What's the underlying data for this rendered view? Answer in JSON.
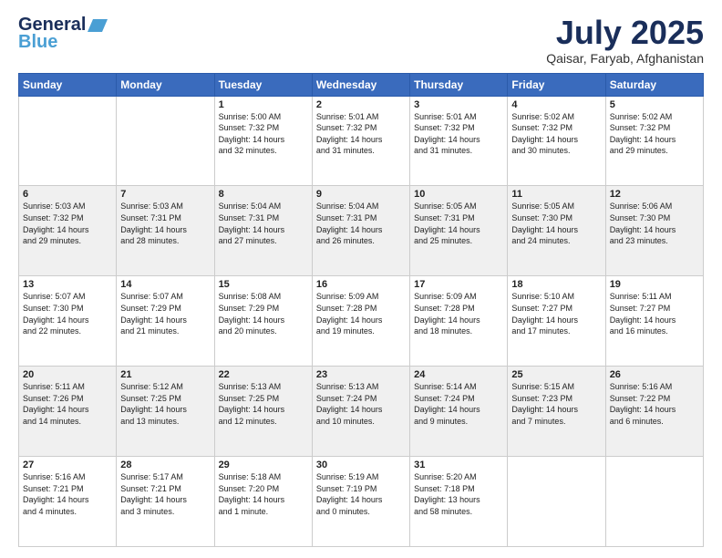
{
  "logo": {
    "line1": "General",
    "line2": "Blue"
  },
  "title": "July 2025",
  "subtitle": "Qaisar, Faryab, Afghanistan",
  "weekdays": [
    "Sunday",
    "Monday",
    "Tuesday",
    "Wednesday",
    "Thursday",
    "Friday",
    "Saturday"
  ],
  "weeks": [
    [
      {
        "day": "",
        "info": ""
      },
      {
        "day": "",
        "info": ""
      },
      {
        "day": "1",
        "info": "Sunrise: 5:00 AM\nSunset: 7:32 PM\nDaylight: 14 hours\nand 32 minutes."
      },
      {
        "day": "2",
        "info": "Sunrise: 5:01 AM\nSunset: 7:32 PM\nDaylight: 14 hours\nand 31 minutes."
      },
      {
        "day": "3",
        "info": "Sunrise: 5:01 AM\nSunset: 7:32 PM\nDaylight: 14 hours\nand 31 minutes."
      },
      {
        "day": "4",
        "info": "Sunrise: 5:02 AM\nSunset: 7:32 PM\nDaylight: 14 hours\nand 30 minutes."
      },
      {
        "day": "5",
        "info": "Sunrise: 5:02 AM\nSunset: 7:32 PM\nDaylight: 14 hours\nand 29 minutes."
      }
    ],
    [
      {
        "day": "6",
        "info": "Sunrise: 5:03 AM\nSunset: 7:32 PM\nDaylight: 14 hours\nand 29 minutes."
      },
      {
        "day": "7",
        "info": "Sunrise: 5:03 AM\nSunset: 7:31 PM\nDaylight: 14 hours\nand 28 minutes."
      },
      {
        "day": "8",
        "info": "Sunrise: 5:04 AM\nSunset: 7:31 PM\nDaylight: 14 hours\nand 27 minutes."
      },
      {
        "day": "9",
        "info": "Sunrise: 5:04 AM\nSunset: 7:31 PM\nDaylight: 14 hours\nand 26 minutes."
      },
      {
        "day": "10",
        "info": "Sunrise: 5:05 AM\nSunset: 7:31 PM\nDaylight: 14 hours\nand 25 minutes."
      },
      {
        "day": "11",
        "info": "Sunrise: 5:05 AM\nSunset: 7:30 PM\nDaylight: 14 hours\nand 24 minutes."
      },
      {
        "day": "12",
        "info": "Sunrise: 5:06 AM\nSunset: 7:30 PM\nDaylight: 14 hours\nand 23 minutes."
      }
    ],
    [
      {
        "day": "13",
        "info": "Sunrise: 5:07 AM\nSunset: 7:30 PM\nDaylight: 14 hours\nand 22 minutes."
      },
      {
        "day": "14",
        "info": "Sunrise: 5:07 AM\nSunset: 7:29 PM\nDaylight: 14 hours\nand 21 minutes."
      },
      {
        "day": "15",
        "info": "Sunrise: 5:08 AM\nSunset: 7:29 PM\nDaylight: 14 hours\nand 20 minutes."
      },
      {
        "day": "16",
        "info": "Sunrise: 5:09 AM\nSunset: 7:28 PM\nDaylight: 14 hours\nand 19 minutes."
      },
      {
        "day": "17",
        "info": "Sunrise: 5:09 AM\nSunset: 7:28 PM\nDaylight: 14 hours\nand 18 minutes."
      },
      {
        "day": "18",
        "info": "Sunrise: 5:10 AM\nSunset: 7:27 PM\nDaylight: 14 hours\nand 17 minutes."
      },
      {
        "day": "19",
        "info": "Sunrise: 5:11 AM\nSunset: 7:27 PM\nDaylight: 14 hours\nand 16 minutes."
      }
    ],
    [
      {
        "day": "20",
        "info": "Sunrise: 5:11 AM\nSunset: 7:26 PM\nDaylight: 14 hours\nand 14 minutes."
      },
      {
        "day": "21",
        "info": "Sunrise: 5:12 AM\nSunset: 7:25 PM\nDaylight: 14 hours\nand 13 minutes."
      },
      {
        "day": "22",
        "info": "Sunrise: 5:13 AM\nSunset: 7:25 PM\nDaylight: 14 hours\nand 12 minutes."
      },
      {
        "day": "23",
        "info": "Sunrise: 5:13 AM\nSunset: 7:24 PM\nDaylight: 14 hours\nand 10 minutes."
      },
      {
        "day": "24",
        "info": "Sunrise: 5:14 AM\nSunset: 7:24 PM\nDaylight: 14 hours\nand 9 minutes."
      },
      {
        "day": "25",
        "info": "Sunrise: 5:15 AM\nSunset: 7:23 PM\nDaylight: 14 hours\nand 7 minutes."
      },
      {
        "day": "26",
        "info": "Sunrise: 5:16 AM\nSunset: 7:22 PM\nDaylight: 14 hours\nand 6 minutes."
      }
    ],
    [
      {
        "day": "27",
        "info": "Sunrise: 5:16 AM\nSunset: 7:21 PM\nDaylight: 14 hours\nand 4 minutes."
      },
      {
        "day": "28",
        "info": "Sunrise: 5:17 AM\nSunset: 7:21 PM\nDaylight: 14 hours\nand 3 minutes."
      },
      {
        "day": "29",
        "info": "Sunrise: 5:18 AM\nSunset: 7:20 PM\nDaylight: 14 hours\nand 1 minute."
      },
      {
        "day": "30",
        "info": "Sunrise: 5:19 AM\nSunset: 7:19 PM\nDaylight: 14 hours\nand 0 minutes."
      },
      {
        "day": "31",
        "info": "Sunrise: 5:20 AM\nSunset: 7:18 PM\nDaylight: 13 hours\nand 58 minutes."
      },
      {
        "day": "",
        "info": ""
      },
      {
        "day": "",
        "info": ""
      }
    ]
  ]
}
